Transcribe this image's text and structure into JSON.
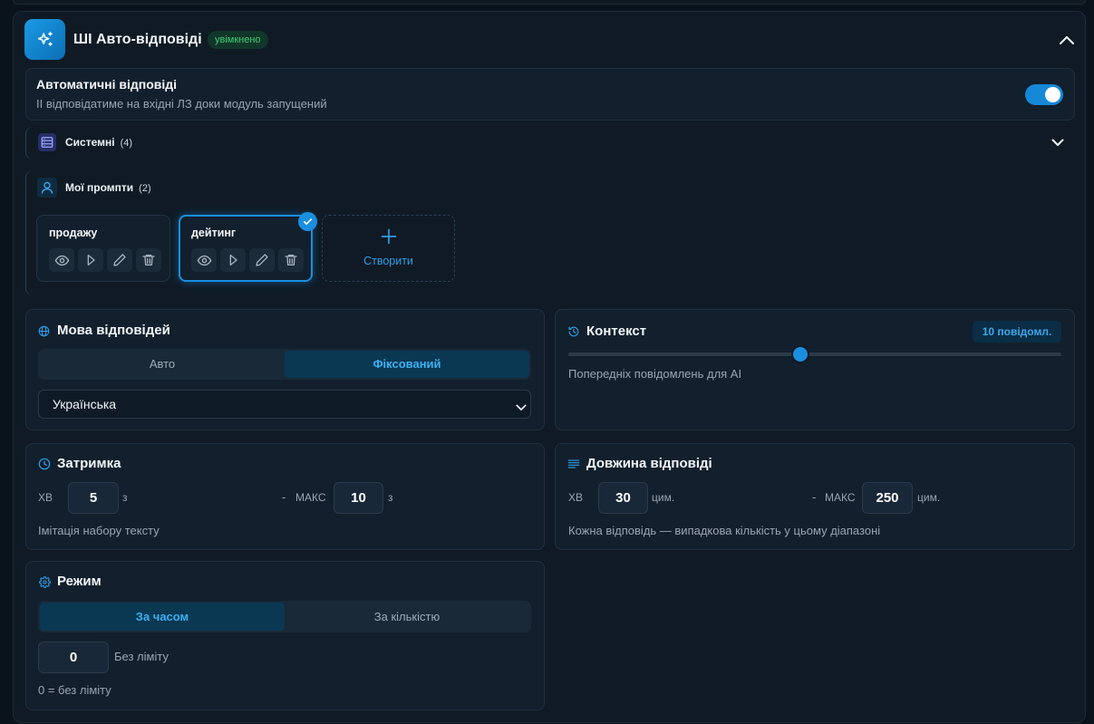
{
  "header": {
    "icon": "sparkles-icon",
    "title": "ШІ Авто-відповіді",
    "status_badge": "увімкнено",
    "collapse_icon": "chevron-up-icon"
  },
  "auto_replies": {
    "title": "Автоматичні відповіді",
    "description": "ІІ відповідатиме на вхідні ЛЗ доки модуль запущений",
    "enabled": true
  },
  "system_prompts": {
    "icon": "list-icon",
    "label": "Системні",
    "count": "(4)",
    "expand_icon": "chevron-down-icon"
  },
  "my_prompts": {
    "icon": "user-icon",
    "label": "Мої промпти",
    "count": "(2)",
    "items": [
      {
        "name": "продажу",
        "selected": false,
        "actions": [
          "eye-icon",
          "play-icon",
          "pencil-icon",
          "trash-icon"
        ]
      },
      {
        "name": "дейтинг",
        "selected": true,
        "actions": [
          "eye-icon",
          "play-icon",
          "pencil-icon",
          "trash-icon"
        ]
      }
    ],
    "create": {
      "icon": "plus-icon",
      "label": "Створити"
    }
  },
  "language": {
    "icon": "globe-icon",
    "title": "Мова відповідей",
    "modes": [
      "Авто",
      "Фіксований"
    ],
    "active_mode_index": 1,
    "selected_language": "Українська"
  },
  "context": {
    "icon": "history-icon",
    "title": "Контекст",
    "badge": "10 повідомл.",
    "slider_level": 0.47,
    "description": "Попередніх повідомлень для АІ"
  },
  "delay": {
    "icon": "clock-icon",
    "title": "Затримка",
    "min_label": "ХВ",
    "min_value": "5",
    "min_unit": "з",
    "separator": "-",
    "max_label": "МАКС",
    "max_value": "10",
    "max_unit": "з",
    "description": "Імітація набору тексту"
  },
  "length": {
    "icon": "text-lines-icon",
    "title": "Довжина відповіді",
    "min_label": "ХВ",
    "min_value": "30",
    "min_unit": "цим.",
    "separator": "-",
    "max_label": "МАКС",
    "max_value": "250",
    "max_unit": "цим.",
    "description": "Кожна відповідь — випадкова кількість у цьому діапазоні"
  },
  "mode": {
    "icon": "gear-icon",
    "title": "Режим",
    "modes": [
      "За часом",
      "За кількістю"
    ],
    "active_mode_index": 0,
    "limit_value": "0",
    "limit_label": "Без ліміту",
    "hint": "0 = без ліміту"
  },
  "colors": {
    "accent": "#1a8fe0",
    "accent_text": "#3cb0f2",
    "success": "#3ecf77",
    "page_background": "#0a131c",
    "panel": "#0f1a24",
    "card": "#121f2c",
    "text_muted": "#98a6b4"
  }
}
